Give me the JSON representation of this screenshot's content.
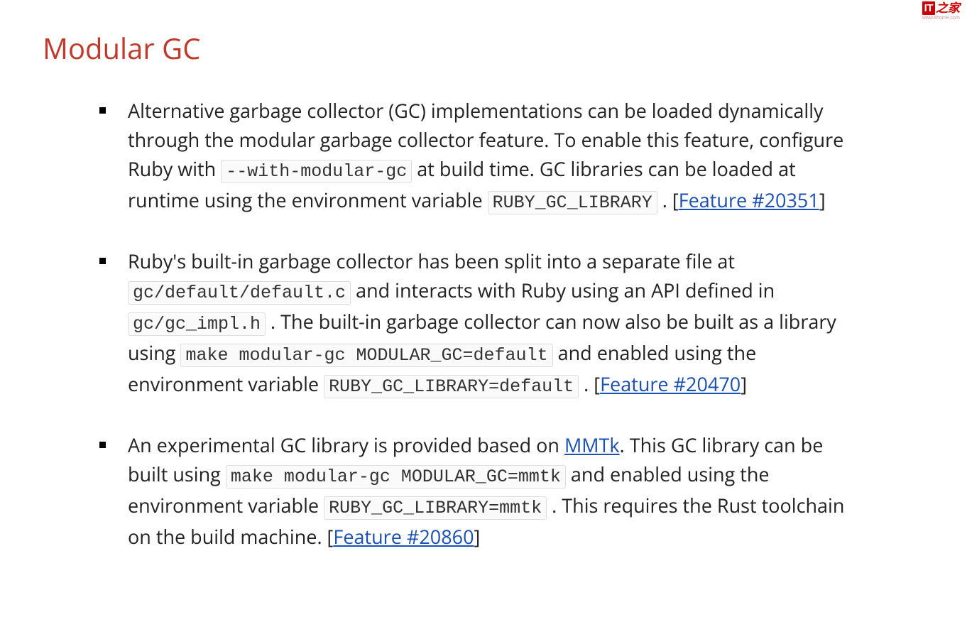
{
  "watermark": {
    "logo_left": "IT",
    "logo_right": "之家",
    "url": "www.ithome.com"
  },
  "heading": "Modular GC",
  "items": [
    {
      "t1": "Alternative garbage collector (GC) implementations can be loaded dynamically through the modular garbage collector feature. To enable this feature, configure Ruby with ",
      "c1": "--with-modular-gc",
      "t2": " at build time. GC libraries can be loaded at runtime using the environment variable ",
      "c2": "RUBY_GC_LIBRARY",
      "t3": ". [",
      "link1": "Feature #20351",
      "t4": "]"
    },
    {
      "t1": "Ruby's built-in garbage collector has been split into a separate file at ",
      "c1": "gc/default/default.c",
      "t2": " and interacts with Ruby using an API defined in ",
      "c2": "gc/gc_impl.h",
      "t3": ". The built-in garbage collector can now also be built as a library using ",
      "c3": "make modular-gc MODULAR_GC=default",
      "t4": " and enabled using the environment variable ",
      "c4": "RUBY_GC_LIBRARY=default",
      "t5": ". [",
      "link1": "Feature #20470",
      "t6": "]"
    },
    {
      "t1": "An experimental GC library is provided based on ",
      "link1": "MMTk",
      "t2": ". This GC library can be built using ",
      "c1": "make modular-gc MODULAR_GC=mmtk",
      "t3": " and enabled using the environment variable ",
      "c2": "RUBY_GC_LIBRARY=mmtk",
      "t4": ". This requires the Rust toolchain on the build machine. [",
      "link2": "Feature #20860",
      "t5": "]"
    }
  ]
}
